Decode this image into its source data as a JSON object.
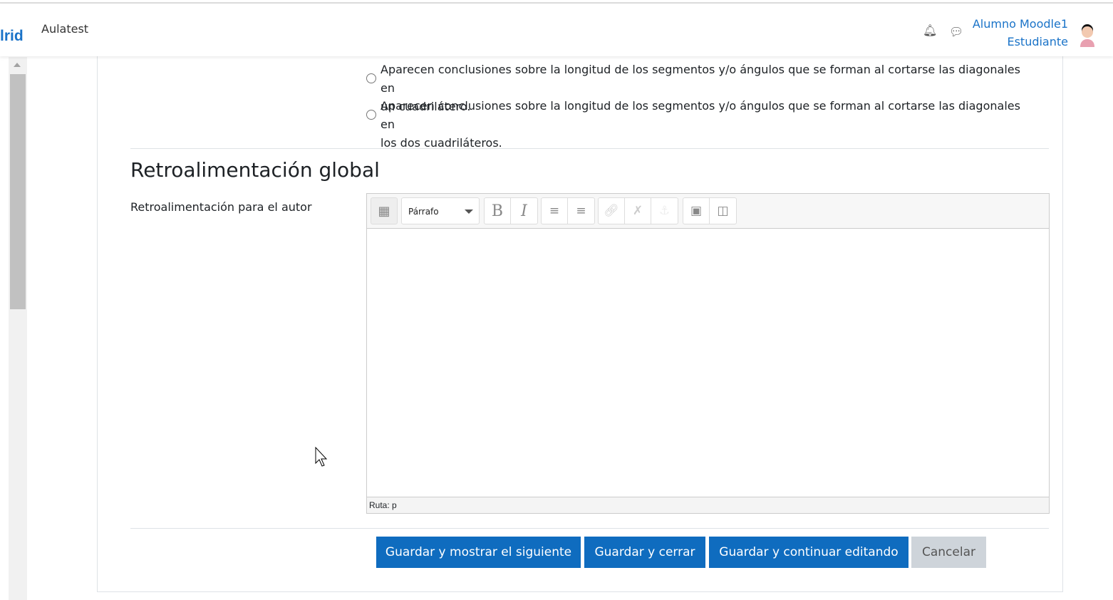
{
  "header": {
    "brand": "lrid",
    "site_name": "Aulatest",
    "user_name": "Alumno Moodle1",
    "user_role": "Estudiante"
  },
  "options": [
    {
      "line1": "Aparecen conclusiones sobre la longitud de los segmentos y/o ángulos que se forman al cortarse las diagonales en",
      "line2": "un cuadrilátero."
    },
    {
      "line1": "Aparecen conclusiones sobre la longitud de los segmentos y/o ángulos que se forman al cortarse las diagonales en",
      "line2": "los dos cuadriláteros."
    }
  ],
  "section": {
    "title": "Retroalimentación global",
    "field_label": "Retroalimentación para el autor"
  },
  "editor": {
    "format": "Párrafo",
    "bold": "B",
    "italic": "I",
    "path": "Ruta: p"
  },
  "buttons": {
    "save_next": "Guardar y mostrar el siguiente",
    "save_close": "Guardar y cerrar",
    "save_continue": "Guardar y continuar editando",
    "cancel": "Cancelar"
  }
}
